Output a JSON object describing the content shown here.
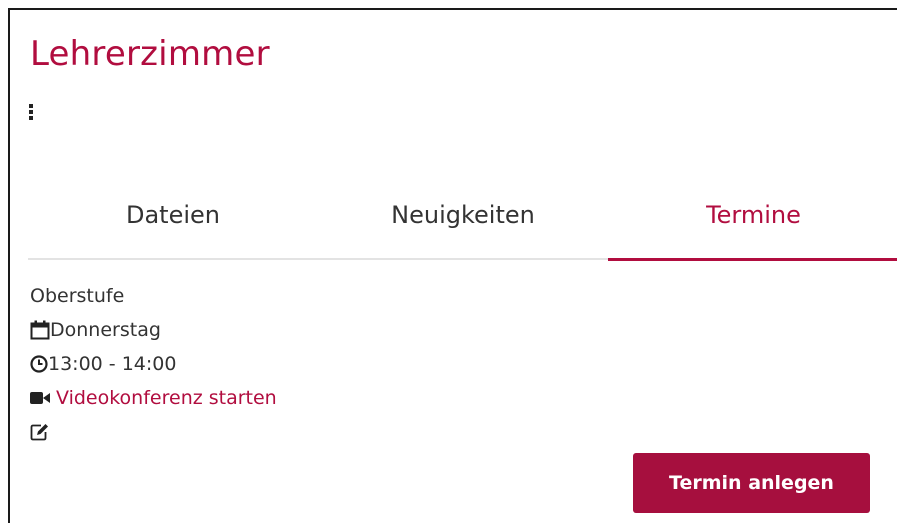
{
  "header": {
    "title": "Lehrerzimmer"
  },
  "tabs": [
    {
      "label": "Dateien",
      "active": false
    },
    {
      "label": "Neuigkeiten",
      "active": false
    },
    {
      "label": "Termine",
      "active": true
    }
  ],
  "event": {
    "name": "Oberstufe",
    "day": "Donnerstag",
    "time": "13:00 - 14:00",
    "video_link": "Videokonferenz starten",
    "icons": [
      "calendar-icon",
      "clock-icon",
      "video-camera-icon",
      "edit-icon"
    ]
  },
  "actions": {
    "create_label": "Termin anlegen"
  },
  "colors": {
    "accent": "#b10d3f",
    "button": "#a60f3e",
    "text": "#333333",
    "divider": "#e3e3e3"
  }
}
